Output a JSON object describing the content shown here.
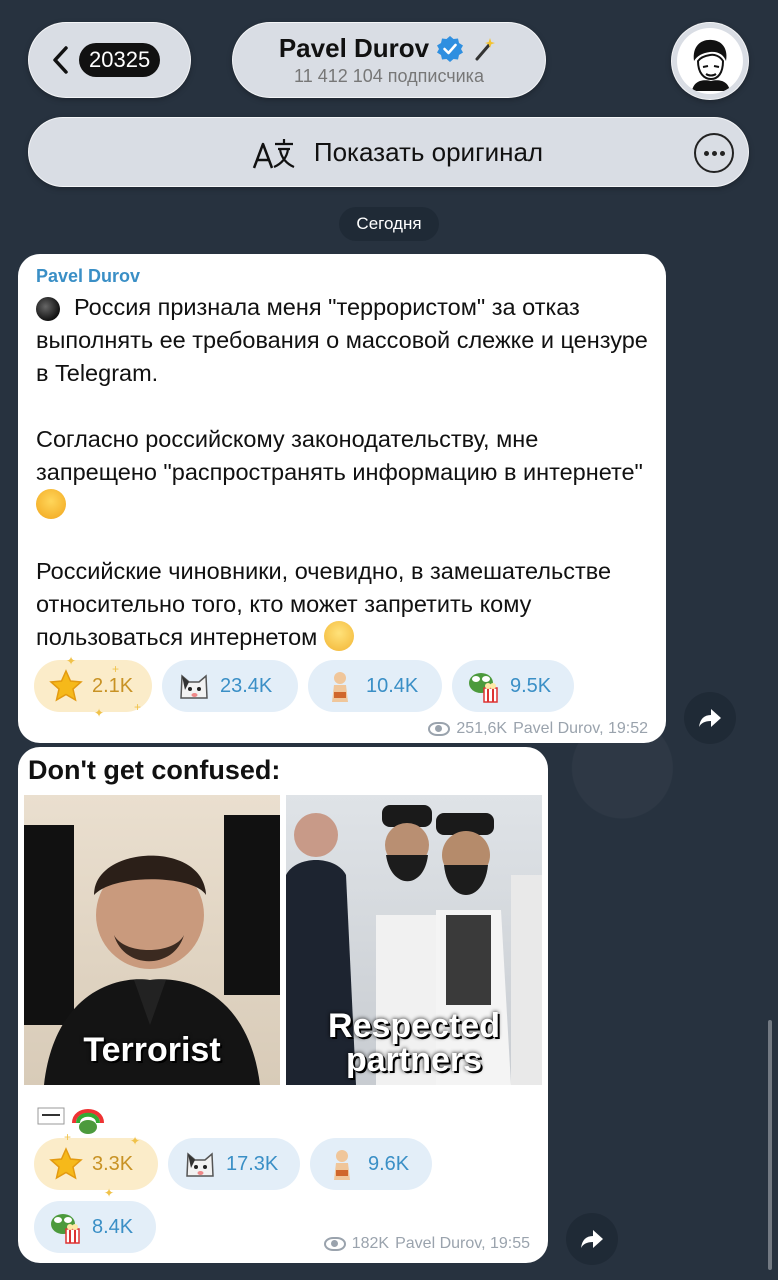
{
  "header": {
    "back_count": "20325",
    "channel_name": "Pavel Durov",
    "subscribers": "11 412 104 подписчика",
    "translate_label": "Показать оригинал"
  },
  "date_chip": "Сегодня",
  "post1": {
    "author": "Pavel Durov",
    "paragraphs": [
      "Россия признала меня \"террористом\" за отказ выполнять ее требования о массовой слежке и цензуре в Telegram.",
      "Согласно российскому законодательству, мне запрещено \"распространять информацию в интернете\"",
      "Российские чиновники, очевидно, в замешательстве относительно того, кто может запретить кому пользоваться интернетом"
    ],
    "reactions": [
      {
        "icon": "star-icon",
        "count": "2.1K"
      },
      {
        "icon": "cat-icon",
        "count": "23.4K"
      },
      {
        "icon": "figure-icon",
        "count": "10.4K"
      },
      {
        "icon": "frog-popcorn-icon",
        "count": "9.5K"
      }
    ],
    "views": "251,6K",
    "signature": "Pavel Durov, 19:52"
  },
  "post2": {
    "meme_title": "Don't get confused:",
    "left_caption": "Terrorist",
    "right_caption_1": "Respected",
    "right_caption_2": "partners",
    "reactions": [
      {
        "icon": "star-icon",
        "count": "3.3K"
      },
      {
        "icon": "cat-icon",
        "count": "17.3K"
      },
      {
        "icon": "figure-icon",
        "count": "9.6K"
      },
      {
        "icon": "frog-popcorn-icon",
        "count": "8.4K"
      }
    ],
    "views": "182K",
    "signature": "Pavel Durov, 19:55"
  },
  "colors": {
    "background": "#27323f",
    "accent": "#3a8fc6",
    "star_reaction_bg": "#fbecc9",
    "reaction_bg": "#e3eef8"
  }
}
